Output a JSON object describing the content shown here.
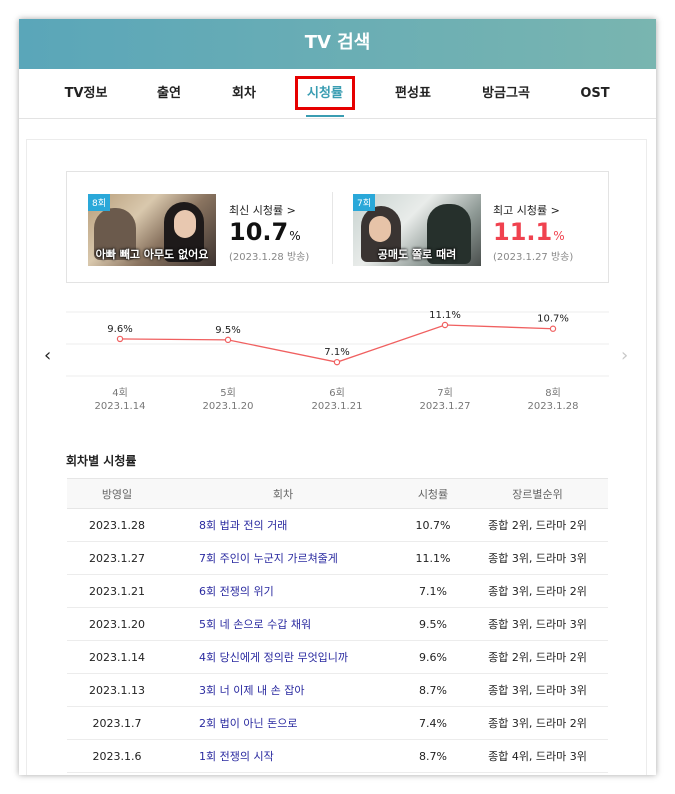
{
  "header": {
    "title": "TV 검색"
  },
  "tabs": [
    {
      "label": "TV정보"
    },
    {
      "label": "출연"
    },
    {
      "label": "회차"
    },
    {
      "label": "시청률",
      "active": true
    },
    {
      "label": "편성표"
    },
    {
      "label": "방금그곡"
    },
    {
      "label": "OST"
    }
  ],
  "summary": {
    "latest": {
      "badge": "8회",
      "caption": "아빠 빼고 아무도 없어요",
      "label": "최신 시청률 >",
      "value": "10.7",
      "unit": "%",
      "date": "(2023.1.28 방송)"
    },
    "best": {
      "badge": "7회",
      "caption": "공매도 쫄로 때려",
      "label": "최고 시청률 >",
      "value": "11.1",
      "unit": "%",
      "date": "(2023.1.27 방송)"
    }
  },
  "chart_data": {
    "type": "line",
    "categories": [
      "4회",
      "5회",
      "6회",
      "7회",
      "8회"
    ],
    "dates": [
      "2023.1.14",
      "2023.1.20",
      "2023.1.21",
      "2023.1.27",
      "2023.1.28"
    ],
    "values": [
      9.6,
      9.5,
      7.1,
      11.1,
      10.7
    ],
    "data_labels": [
      "9.6%",
      "9.5%",
      "7.1%",
      "11.1%",
      "10.7%"
    ],
    "color": "#f06060",
    "grid": true
  },
  "table": {
    "title": "회차별 시청률",
    "headers": [
      "방영일",
      "회차",
      "시청률",
      "장르별순위"
    ],
    "rows": [
      [
        "2023.1.28",
        "8회 법과 전의 거래",
        "10.7%",
        "종합 2위, 드라마 2위"
      ],
      [
        "2023.1.27",
        "7회 주인이 누군지 가르쳐줄게",
        "11.1%",
        "종합 3위, 드라마 3위"
      ],
      [
        "2023.1.21",
        "6회 전쟁의 위기",
        "7.1%",
        "종합 3위, 드라마 2위"
      ],
      [
        "2023.1.20",
        "5회 네 손으로 수갑 채워",
        "9.5%",
        "종합 3위, 드라마 3위"
      ],
      [
        "2023.1.14",
        "4회 당신에게 정의란 무엇입니까",
        "9.6%",
        "종합 2위, 드라마 2위"
      ],
      [
        "2023.1.13",
        "3회 너 이제 내 손 잡아",
        "8.7%",
        "종합 3위, 드라마 3위"
      ],
      [
        "2023.1.7",
        "2회 법이 아닌 돈으로",
        "7.4%",
        "종합 3위, 드라마 2위"
      ],
      [
        "2023.1.6",
        "1회 전쟁의 시작",
        "8.7%",
        "종합 4위, 드라마 3위"
      ]
    ]
  },
  "nav": {
    "prev_icon": "chevron-left-icon",
    "next_icon": "chevron-right-icon"
  }
}
